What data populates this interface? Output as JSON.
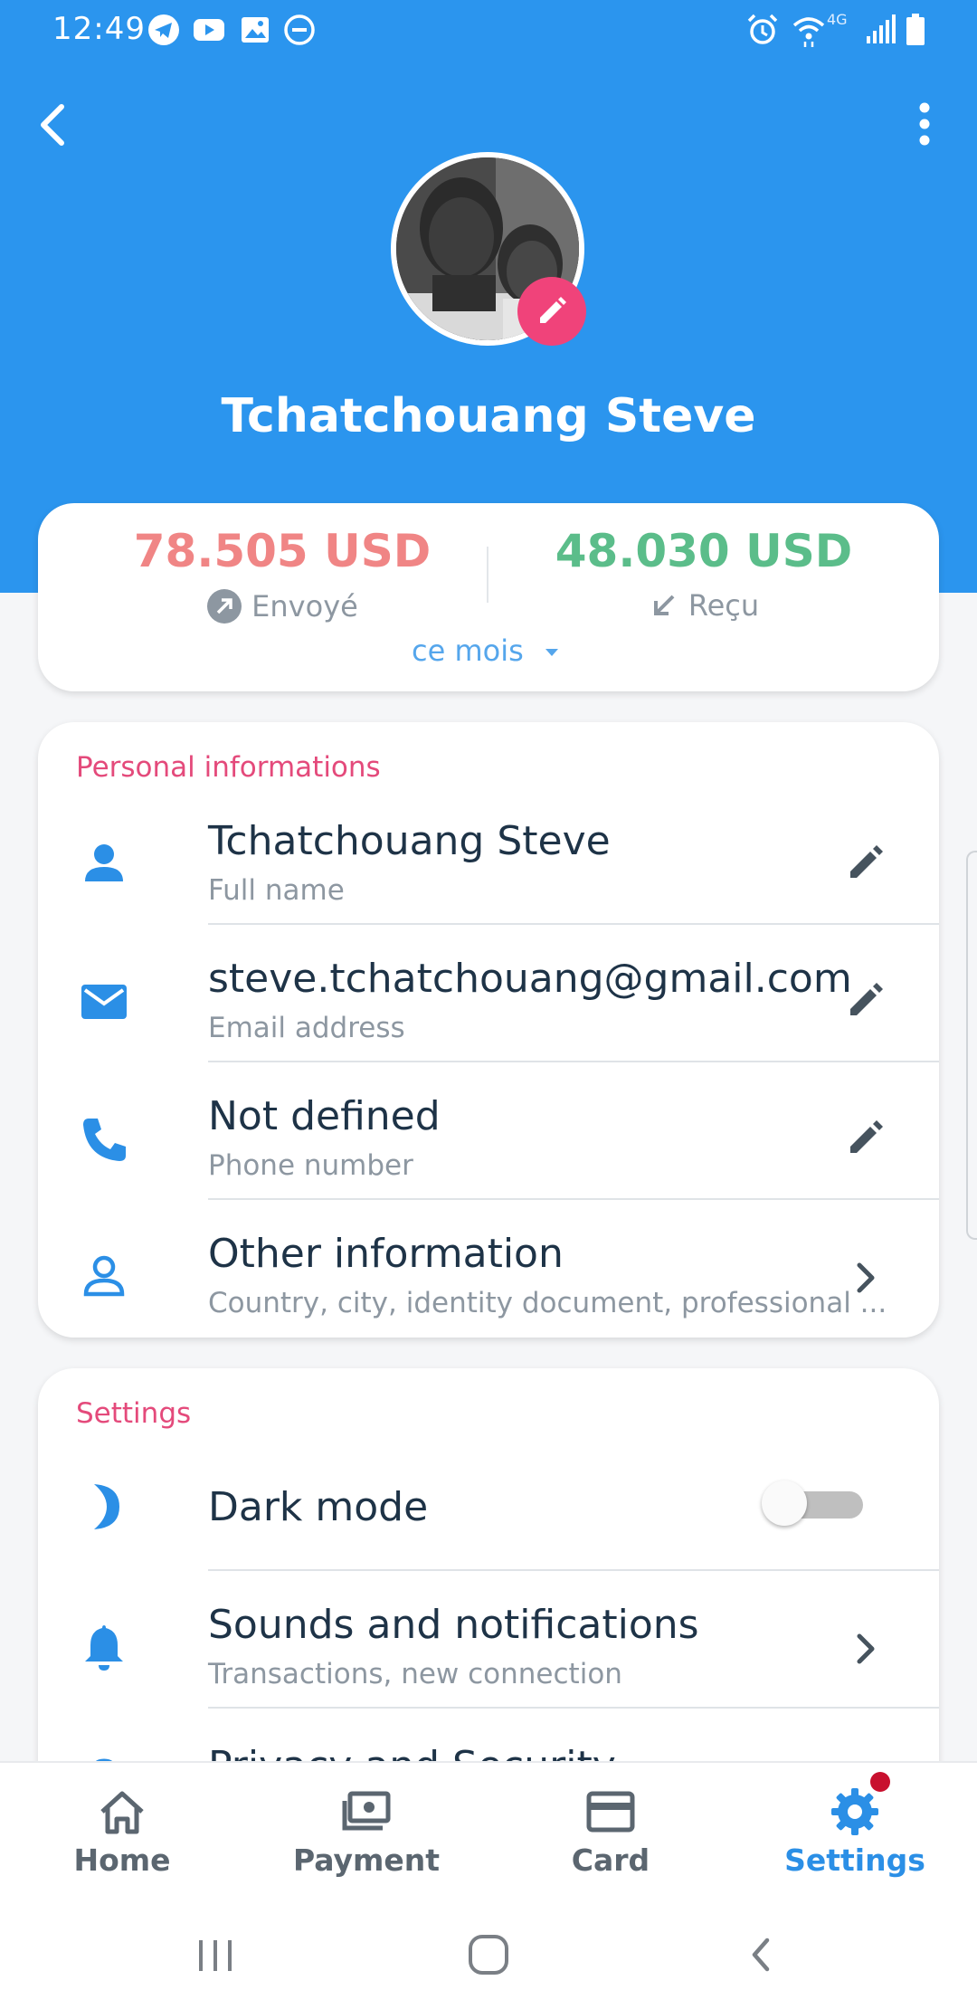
{
  "status_bar": {
    "time": "12:49",
    "left_icons": [
      "telegram-icon",
      "youtube-icon",
      "gallery-icon",
      "do-not-disturb-icon"
    ],
    "right_icons": [
      "alarm-icon",
      "wifi-icon",
      "4g-icon",
      "signal-icon",
      "battery-icon"
    ],
    "network": "4G"
  },
  "toolbar": {
    "back_icon": "chevron-left-icon",
    "menu_icon": "more-vert-icon"
  },
  "profile": {
    "name": "Tchatchouang Steve",
    "edit_icon": "pencil-icon"
  },
  "stats": {
    "sent_amount": "78.505 USD",
    "sent_label": "Envoyé",
    "received_amount": "48.030 USD",
    "received_label": "Reçu",
    "period": "ce mois",
    "sent_color": "#f08585",
    "received_color": "#5bbd8a"
  },
  "personal": {
    "title": "Personal informations",
    "items": [
      {
        "title": "Tchatchouang Steve",
        "subtitle": "Full name",
        "icon": "person-icon",
        "action": "pencil-icon"
      },
      {
        "title": "steve.tchatchouang@gmail.com",
        "subtitle": "Email address",
        "icon": "mail-icon",
        "action": "pencil-icon"
      },
      {
        "title": "Not defined",
        "subtitle": "Phone number",
        "icon": "phone-icon",
        "action": "pencil-icon"
      },
      {
        "title": "Other information",
        "subtitle": "Country, city, identity document, professional ...",
        "icon": "person-outline-icon",
        "action": "chevron-right-icon"
      }
    ]
  },
  "settings": {
    "title": "Settings",
    "items": [
      {
        "title": "Dark mode",
        "icon": "moon-icon",
        "toggle": false
      },
      {
        "title": "Sounds and notifications",
        "subtitle": "Transactions, new connection",
        "icon": "bell-icon",
        "action": "chevron-right-icon"
      },
      {
        "title": "Privacy and Security",
        "icon": "lock-icon"
      }
    ]
  },
  "bottom_nav": {
    "items": [
      {
        "label": "Home",
        "icon": "home-icon"
      },
      {
        "label": "Payment",
        "icon": "payment-icon"
      },
      {
        "label": "Card",
        "icon": "credit-card-icon"
      },
      {
        "label": "Settings",
        "icon": "gear-icon"
      }
    ],
    "active": "Settings",
    "accent": "#2b8fe6"
  },
  "colors": {
    "header": "#2b95ee",
    "section_title": "#e44a7b",
    "icon_blue": "#2b8fe6",
    "edit_badge": "#f0437a"
  }
}
